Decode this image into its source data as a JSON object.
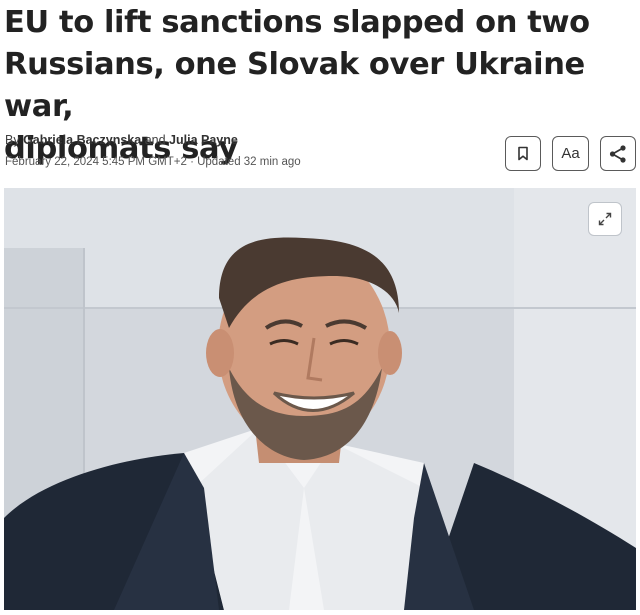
{
  "article": {
    "headline_lines": [
      "EU to lift sanctions slapped on two",
      "Russians, one Slovak over Ukraine war,",
      "diplomats say"
    ],
    "byline_prefix": "By",
    "author_1": "Gabriela Baczynska",
    "byline_and": "and",
    "author_2": "Julia Payne",
    "date": "February 22, 2024 5:45 PM GMT+2",
    "separator": "·",
    "updated": "Updated 32 min ago"
  },
  "actions": {
    "bookmark_icon": "bookmark-icon",
    "text_size_label": "Aa",
    "share_icon": "share-icon"
  },
  "image": {
    "expand_icon": "expand-icon"
  }
}
